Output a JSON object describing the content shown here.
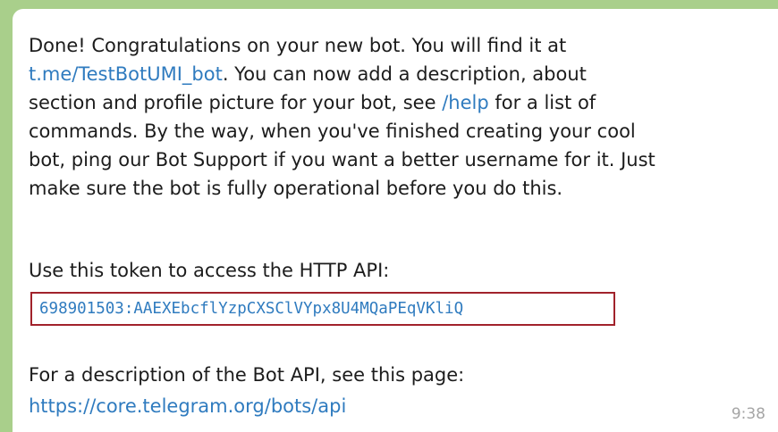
{
  "message": {
    "line1": "Done! Congratulations on your new bot. You will find it at",
    "bot_link": "t.me/TestBotUMI_bot",
    "line2_rest": ". You can now add a description, about",
    "line3_pre": "section and profile picture for your bot, see ",
    "help_link": "/help",
    "line3_post": " for a list of",
    "line4": "commands. By the way, when you've finished creating your cool",
    "line5": "bot, ping our Bot Support if you want a better username for it. Just",
    "line6": "make sure the bot is fully operational before you do this.",
    "token_label": "Use this token to access the HTTP API:",
    "token": "698901503:AAEXEbcflYzpCXSClVYpx8U4MQaPEqVKliQ",
    "api_desc": "For a description of the Bot API, see this page:",
    "api_link": "https://core.telegram.org/bots/api",
    "time": "9:38"
  },
  "colors": {
    "chat_background": "#a9cf8b",
    "bubble": "#ffffff",
    "link": "#2f7bbf",
    "highlight_border": "#a1222b",
    "time": "#a5a5a5"
  }
}
